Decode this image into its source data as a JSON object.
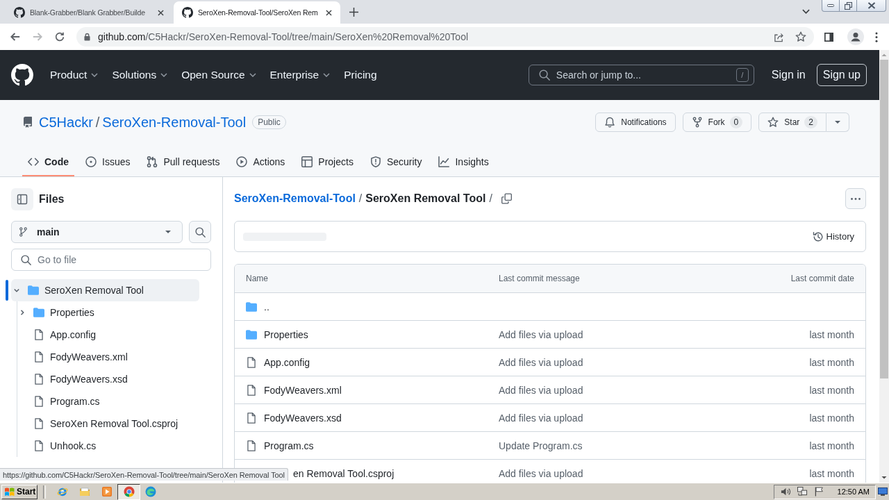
{
  "browser": {
    "tabs": [
      {
        "title": "Blank-Grabber/Blank Grabber/Builde",
        "selected": false
      },
      {
        "title": "SeroXen-Removal-Tool/SeroXen Rem",
        "selected": true
      }
    ],
    "url_host": "github.com",
    "url_path": "/C5Hackr/SeroXen-Removal-Tool/tree/main/SeroXen%20Removal%20Tool",
    "forward_disabled": true
  },
  "header": {
    "nav": [
      {
        "label": "Product",
        "has_menu": true
      },
      {
        "label": "Solutions",
        "has_menu": true
      },
      {
        "label": "Open Source",
        "has_menu": true
      },
      {
        "label": "Enterprise",
        "has_menu": true
      },
      {
        "label": "Pricing",
        "has_menu": false
      }
    ],
    "search": {
      "placeholder": "Search or jump to...",
      "key": "/"
    },
    "sign_in": "Sign in",
    "sign_up": "Sign up"
  },
  "repo": {
    "owner": "C5Hackr",
    "separator": "/",
    "name": "SeroXen-Removal-Tool",
    "visibility": "Public",
    "notifications": "Notifications",
    "fork": {
      "label": "Fork",
      "count": "0"
    },
    "star": {
      "label": "Star",
      "count": "2"
    },
    "tabs": [
      {
        "label": "Code",
        "selected": true
      },
      {
        "label": "Issues",
        "selected": false
      },
      {
        "label": "Pull requests",
        "selected": false
      },
      {
        "label": "Actions",
        "selected": false
      },
      {
        "label": "Projects",
        "selected": false
      },
      {
        "label": "Security",
        "selected": false
      },
      {
        "label": "Insights",
        "selected": false
      }
    ]
  },
  "sidebar": {
    "title": "Files",
    "branch": "main",
    "file_search": {
      "placeholder": "Go to file"
    },
    "tree": [
      {
        "name": "SeroXen Removal Tool",
        "kind": "folder",
        "expanded": true,
        "selected": true,
        "children": [
          {
            "name": "Properties",
            "kind": "folder",
            "expanded": false,
            "selected": false
          },
          {
            "name": "App.config",
            "kind": "file",
            "selected": false
          },
          {
            "name": "FodyWeavers.xml",
            "kind": "file",
            "selected": false
          },
          {
            "name": "FodyWeavers.xsd",
            "kind": "file",
            "selected": false
          },
          {
            "name": "Program.cs",
            "kind": "file",
            "selected": false
          },
          {
            "name": "SeroXen Removal Tool.csproj",
            "kind": "file",
            "selected": false
          },
          {
            "name": "Unhook.cs",
            "kind": "file",
            "selected": false
          }
        ]
      }
    ]
  },
  "content": {
    "breadcrumb": {
      "separator": "/",
      "items": [
        {
          "label": "SeroXen-Removal-Tool",
          "link": true
        },
        {
          "label": "SeroXen Removal Tool",
          "link": false
        }
      ]
    },
    "history": "History",
    "table": {
      "columns": [
        "Name",
        "Last commit message",
        "Last commit date"
      ],
      "rows": [
        {
          "kind": "parent",
          "name": ".."
        },
        {
          "kind": "folder",
          "name": "Properties",
          "message": "Add files via upload",
          "date": "last month"
        },
        {
          "kind": "file",
          "name": "App.config",
          "message": "Add files via upload",
          "date": "last month"
        },
        {
          "kind": "file",
          "name": "FodyWeavers.xml",
          "message": "Add files via upload",
          "date": "last month"
        },
        {
          "kind": "file",
          "name": "FodyWeavers.xsd",
          "message": "Add files via upload",
          "date": "last month"
        },
        {
          "kind": "file",
          "name": "Program.cs",
          "message": "Update Program.cs",
          "date": "last month"
        },
        {
          "kind": "obscured",
          "name": "en Removal Tool.csproj",
          "message": "Add files via upload",
          "date": "last month"
        }
      ]
    }
  },
  "status_bubble": "https://github.com/C5Hackr/SeroXen-Removal-Tool/tree/main/SeroXen Removal Tool",
  "taskbar": {
    "start": "Start",
    "apps": [
      {
        "selected": false
      },
      {
        "selected": false
      },
      {
        "selected": false
      },
      {
        "selected": true
      },
      {
        "selected": false
      }
    ],
    "clock": "12:50 AM"
  }
}
